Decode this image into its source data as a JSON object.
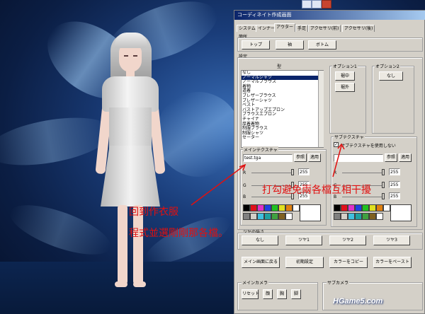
{
  "window": {
    "title": "コーディネイト作成画面"
  },
  "tabs": [
    "システム",
    "インナー",
    "アウター",
    "手足",
    "アクセサリ(前)",
    "アクセサリ(後)"
  ],
  "active_tab": "アウター",
  "category": {
    "label": "箇所",
    "buttons": [
      "トップ",
      "袖",
      "ボトム"
    ]
  },
  "settings": {
    "label": "設定",
    "type_header": "型",
    "type_list": [
      "なし",
      "ノーマルシャツ",
      "ノーマルブラウス",
      "着物",
      "道着",
      "ブレザーブラウス",
      "ブレザーシャツ",
      "ベスト",
      "バストアップエプロン",
      "ブラウスエプロン",
      "チャイナ",
      "厚着着物",
      "制服ブラウス",
      "制服シャツ",
      "セーター"
    ],
    "selected_type": "ノーマルシャツ"
  },
  "option1": {
    "label": "オプション1",
    "buttons": [
      "裾中",
      "裾外"
    ]
  },
  "option2": {
    "label": "オプション2",
    "button": "なし"
  },
  "main_texture": {
    "label": "メインテクスチャ",
    "file": "test.tga",
    "browse": "参照",
    "apply": "適用",
    "channels": [
      {
        "name": "R",
        "value": "255"
      },
      {
        "name": "G",
        "value": "255"
      },
      {
        "name": "B",
        "value": "255"
      }
    ]
  },
  "sub_texture": {
    "label": "サブテクスチャ",
    "checkbox_label": "サブテクスチャを使用しない",
    "checked": true,
    "file": "",
    "browse": "参照",
    "apply": "適用",
    "channels": [
      {
        "name": "R",
        "value": "255"
      },
      {
        "name": "G",
        "value": "255"
      },
      {
        "name": "B",
        "value": "255"
      }
    ]
  },
  "palette": [
    "#000000",
    "#e0101a",
    "#e030c8",
    "#2040e0",
    "#20c020",
    "#e0e020",
    "#e08010",
    "#ffffff",
    "#808080",
    "#d4d0c8",
    "#40c0e0",
    "#20a0a0",
    "#40a040",
    "#806020",
    "#ffffff"
  ],
  "gloss": {
    "label": "ツヤの強さ",
    "buttons": [
      "なし",
      "ツヤ1",
      "ツヤ2",
      "ツヤ3"
    ]
  },
  "actions": [
    "メイン画面に戻る",
    "初期設定",
    "カラーをコピー",
    "カラーをペースト"
  ],
  "main_camera": {
    "label": "メインカメラ",
    "buttons": [
      "リセット",
      "顔",
      "胸",
      "脚"
    ]
  },
  "sub_camera": {
    "label": "サブカメラ"
  },
  "annotations": {
    "checkbox_note": "打勾避免兩各檔互相干擾",
    "note_line1": "回到作衣服",
    "note_line2": "程式並選剛剛那各檔。"
  },
  "watermark": {
    "brand": "HGame5",
    "suffix": ".com"
  },
  "colors": {
    "annotation": "#e01010",
    "titlebar": "#0a246a",
    "dialog_bg": "#d4d0c8"
  }
}
